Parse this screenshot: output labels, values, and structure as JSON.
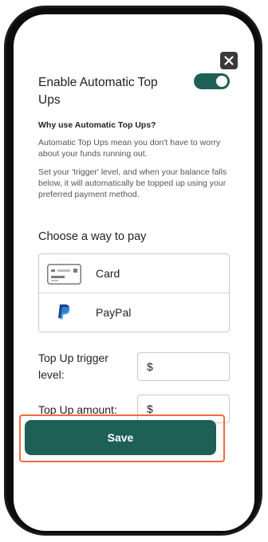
{
  "dialog": {
    "close_label": "×",
    "title": "Enable Automatic Top Ups",
    "toggle_on": true
  },
  "info": {
    "heading": "Why use Automatic Top Ups?",
    "paragraph1": "Automatic Top Ups mean you don't have to worry about your funds running out.",
    "paragraph2": "Set your 'trigger' level, and when your balance falls below, it will automatically be topped up using your preferred payment method."
  },
  "payment": {
    "heading": "Choose a way to pay",
    "options": [
      {
        "label": "Card",
        "icon": "credit-card-icon"
      },
      {
        "label": "PayPal",
        "icon": "paypal-icon"
      }
    ]
  },
  "fields": {
    "trigger_label": "Top Up trigger level:",
    "trigger_prefix": "$",
    "trigger_value": "",
    "amount_label": "Top Up amount:",
    "amount_prefix": "$",
    "amount_value": ""
  },
  "actions": {
    "save_label": "Save"
  },
  "colors": {
    "primary": "#1e5f56",
    "highlight": "#f26a3d"
  }
}
